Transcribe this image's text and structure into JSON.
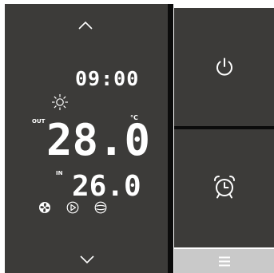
{
  "display": {
    "time": "09:00",
    "out_label": "OUT",
    "unit": "°C",
    "out_temp": "28.0",
    "in_label": "IN",
    "in_temp": "26.0"
  },
  "icons": {
    "up": "chevron-up-icon",
    "down": "chevron-down-icon",
    "sun": "sun-icon",
    "fan": "fan-icon",
    "play": "play-icon",
    "mode": "mode-icon",
    "power": "power-icon",
    "alarm": "alarm-clock-icon",
    "menu": "menu-icon"
  },
  "colors": {
    "panel": "#3c3b39",
    "divider": "#0b0b0b",
    "menu_bar": "#c9c9c9",
    "display_text": "#ffffff"
  }
}
